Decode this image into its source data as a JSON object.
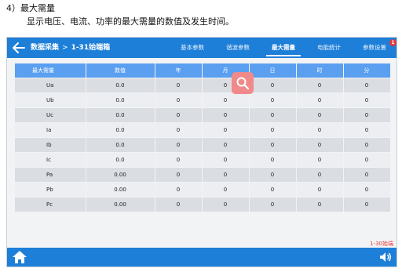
{
  "document": {
    "heading": "4）最大需量",
    "subheading": "显示电压、电流、功率的最大需量的数值及发生时间。"
  },
  "header": {
    "back_icon": "arrow-left-icon",
    "breadcrumb": {
      "section": "数据采集",
      "separator": ">",
      "terminal": "1-31始端箱"
    },
    "tabs": [
      {
        "label": "基本参数",
        "active": false
      },
      {
        "label": "谐波参数",
        "active": false
      },
      {
        "label": "最大需量",
        "active": true
      },
      {
        "label": "电能统计",
        "active": false
      },
      {
        "label": "参数设置",
        "active": false,
        "badge": "1"
      }
    ]
  },
  "table": {
    "columns": [
      "最大需量",
      "数值",
      "年",
      "月",
      "日",
      "时",
      "分"
    ],
    "rows": [
      {
        "name": "Ua",
        "value": "0.0",
        "year": "0",
        "month": "0",
        "day": "0",
        "hour": "0",
        "minute": "0"
      },
      {
        "name": "Ub",
        "value": "0.0",
        "year": "0",
        "month": "0",
        "day": "0",
        "hour": "0",
        "minute": "0"
      },
      {
        "name": "Uc",
        "value": "0.0",
        "year": "0",
        "month": "0",
        "day": "0",
        "hour": "0",
        "minute": "0"
      },
      {
        "name": "Ia",
        "value": "0.0",
        "year": "0",
        "month": "0",
        "day": "0",
        "hour": "0",
        "minute": "0"
      },
      {
        "name": "Ib",
        "value": "0.0",
        "year": "0",
        "month": "0",
        "day": "0",
        "hour": "0",
        "minute": "0"
      },
      {
        "name": "Ic",
        "value": "0.0",
        "year": "0",
        "month": "0",
        "day": "0",
        "hour": "0",
        "minute": "0"
      },
      {
        "name": "Pa",
        "value": "0.00",
        "year": "0",
        "month": "0",
        "day": "0",
        "hour": "0",
        "minute": "0"
      },
      {
        "name": "Pb",
        "value": "0.00",
        "year": "0",
        "month": "0",
        "day": "0",
        "hour": "0",
        "minute": "0"
      },
      {
        "name": "Pc",
        "value": "0.00",
        "year": "0",
        "month": "0",
        "day": "0",
        "hour": "0",
        "minute": "0"
      }
    ]
  },
  "overlay": {
    "icon": "search-icon"
  },
  "footer": {
    "corner_note": "1-30始端",
    "home_icon": "home-icon",
    "volume_icon": "volume-icon"
  },
  "colors": {
    "primary": "#1e7fd8",
    "table_header": "#5a9ff0",
    "row_odd": "#dadde2",
    "row_even": "#eceef1",
    "badge": "#e23b3b",
    "overlay": "#f08a8a",
    "note": "#e33c3c"
  }
}
